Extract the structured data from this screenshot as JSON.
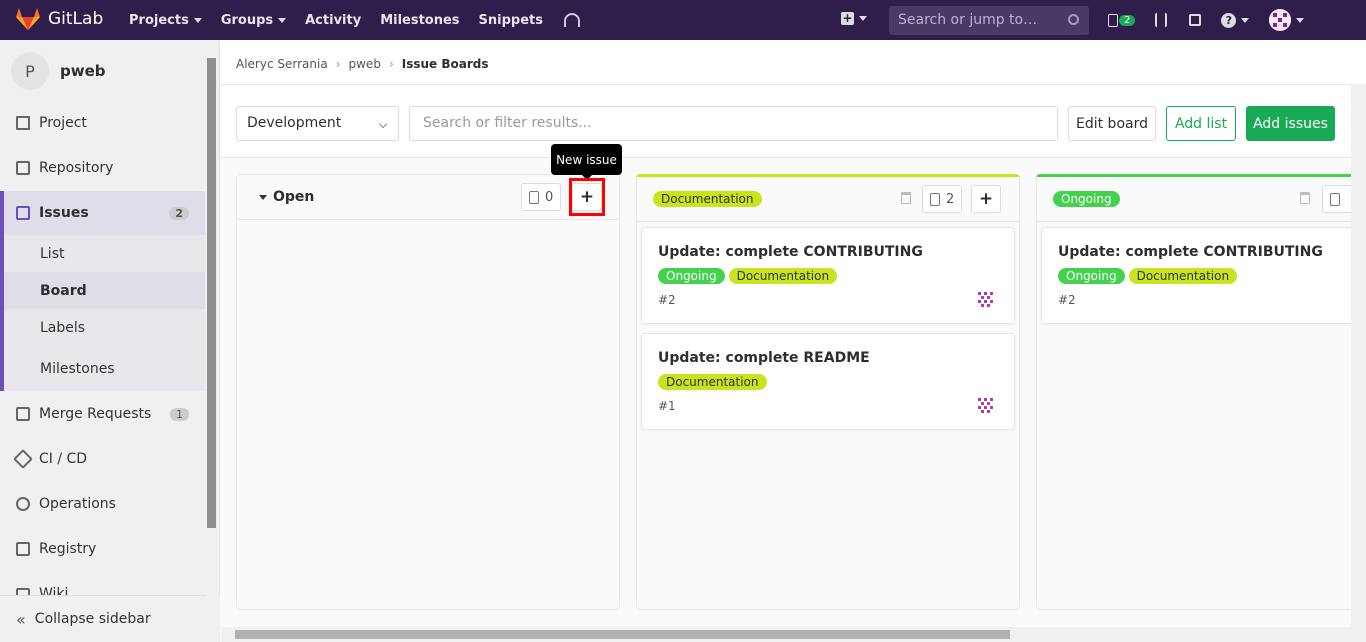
{
  "topbar": {
    "brand": "GitLab",
    "nav": [
      "Projects",
      "Groups",
      "Activity",
      "Milestones",
      "Snippets"
    ],
    "search_placeholder": "Search or jump to…",
    "issues_badge": "2",
    "colors": {
      "bg": "#2f1e4b",
      "green": "#1aaa55"
    }
  },
  "sidebar": {
    "project_initial": "P",
    "project_name": "pweb",
    "items": [
      {
        "label": "Project",
        "icon": "home-icon"
      },
      {
        "label": "Repository",
        "icon": "doc-icon"
      },
      {
        "label": "Issues",
        "icon": "issues-icon",
        "count": "2"
      },
      {
        "label": "Merge Requests",
        "icon": "merge-request-icon",
        "count": "1"
      },
      {
        "label": "CI / CD",
        "icon": "rocket-icon"
      },
      {
        "label": "Operations",
        "icon": "cloud-gear-icon"
      },
      {
        "label": "Registry",
        "icon": "container-icon"
      },
      {
        "label": "Wiki",
        "icon": "book-icon"
      }
    ],
    "sub_items": [
      "List",
      "Board",
      "Labels",
      "Milestones"
    ],
    "collapse": "Collapse sidebar"
  },
  "breadcrumb": {
    "user": "Aleryc Serrania",
    "project": "pweb",
    "current": "Issue Boards"
  },
  "toolbar": {
    "board_select": "Development",
    "filter_placeholder": "Search or filter results...",
    "edit_board": "Edit board",
    "add_list": "Add list",
    "add_issues": "Add issues"
  },
  "tooltip": "New issue",
  "lists": [
    {
      "title": "Open",
      "count": "0"
    },
    {
      "title": "Documentation",
      "count": "2",
      "color": "#c9e31d"
    },
    {
      "title": "Ongoing",
      "color": "#44d14d"
    }
  ],
  "cards": [
    {
      "title": "Update: complete CONTRIBUTING",
      "labels": [
        "Ongoing",
        "Documentation"
      ],
      "ref": "#2"
    },
    {
      "title": "Update: complete README",
      "labels": [
        "Documentation"
      ],
      "ref": "#1"
    },
    {
      "title": "Update: complete CONTRIBUTING",
      "labels": [
        "Ongoing",
        "Documentation"
      ],
      "ref": "#2"
    }
  ]
}
